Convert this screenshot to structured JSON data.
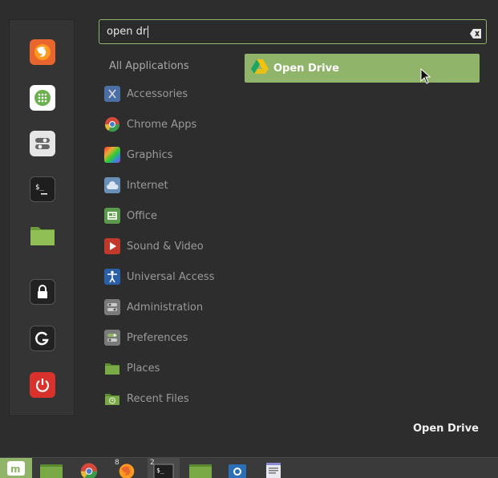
{
  "search": {
    "query": "open dr"
  },
  "categories": {
    "header": "All Applications",
    "items": [
      {
        "label": "Accessories",
        "icon": "accessories-icon",
        "color": "#4a6fa5"
      },
      {
        "label": "Chrome Apps",
        "icon": "chrome-apps-icon",
        "color": "#d44a3a"
      },
      {
        "label": "Graphics",
        "icon": "graphics-icon",
        "color": "#b847c9"
      },
      {
        "label": "Internet",
        "icon": "internet-icon",
        "color": "#6a8fb8"
      },
      {
        "label": "Office",
        "icon": "office-icon",
        "color": "#5a9a4a"
      },
      {
        "label": "Sound & Video",
        "icon": "sound-video-icon",
        "color": "#c0392b"
      },
      {
        "label": "Universal Access",
        "icon": "universal-access-icon",
        "color": "#2a5fa8"
      },
      {
        "label": "Administration",
        "icon": "administration-icon",
        "color": "#7a7a7a"
      },
      {
        "label": "Preferences",
        "icon": "preferences-icon",
        "color": "#7a7a7a"
      },
      {
        "label": "Places",
        "icon": "places-folder-icon",
        "color": "#6a9a3a"
      },
      {
        "label": "Recent Files",
        "icon": "recent-files-icon",
        "color": "#6a9a3a"
      }
    ]
  },
  "results": [
    {
      "label": "Open Drive",
      "icon": "google-drive-icon"
    }
  ],
  "description": {
    "title": "Open Drive"
  },
  "taskbar": {
    "firefox_count": "8",
    "terminal_count": "2"
  },
  "colors": {
    "accent": "#8fb46a",
    "background": "#2e2e2e"
  }
}
